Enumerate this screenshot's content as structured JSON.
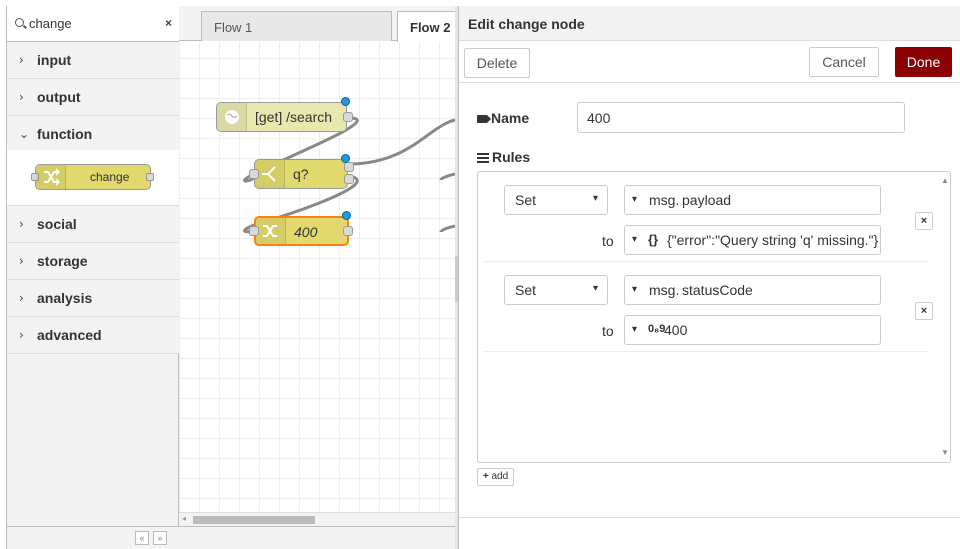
{
  "palette": {
    "search_value": "change",
    "clear_label": "×",
    "categories": [
      {
        "label": "input",
        "state": "collapsed"
      },
      {
        "label": "output",
        "state": "collapsed"
      },
      {
        "label": "function",
        "state": "expanded"
      },
      {
        "label": "social",
        "state": "collapsed"
      },
      {
        "label": "storage",
        "state": "collapsed"
      },
      {
        "label": "analysis",
        "state": "collapsed"
      },
      {
        "label": "advanced",
        "state": "collapsed"
      }
    ],
    "node": {
      "label": "change",
      "color": "#e2d96e"
    },
    "footer": {
      "collapse_all": "«",
      "expand_all": "»"
    }
  },
  "workspace": {
    "tabs": [
      {
        "label": "Flow 1",
        "active": false
      },
      {
        "label": "Flow 2",
        "active": true
      }
    ],
    "nodes": [
      {
        "label": "[get] /search",
        "type": "http in",
        "color": "#e7e7ae"
      },
      {
        "label": "q?",
        "type": "switch",
        "color": "#e2d96e"
      },
      {
        "label": "400",
        "type": "change",
        "color": "#e2d96e",
        "selected": true
      }
    ]
  },
  "tray": {
    "title": "Edit change node",
    "delete_label": "Delete",
    "cancel_label": "Cancel",
    "done_label": "Done",
    "done_color": "#8b0000",
    "name_label": "Name",
    "name_value": "400",
    "rules_label": "Rules",
    "to_label": "to",
    "rules": [
      {
        "op": "Set",
        "target_type": "msg.",
        "target": "payload",
        "value_type": "{}",
        "value": "{\"error\":\"Query string 'q' missing.\"}"
      },
      {
        "op": "Set",
        "target_type": "msg.",
        "target": "statusCode",
        "value_type": "0₈9",
        "value": "400"
      }
    ],
    "add_label": "add"
  }
}
